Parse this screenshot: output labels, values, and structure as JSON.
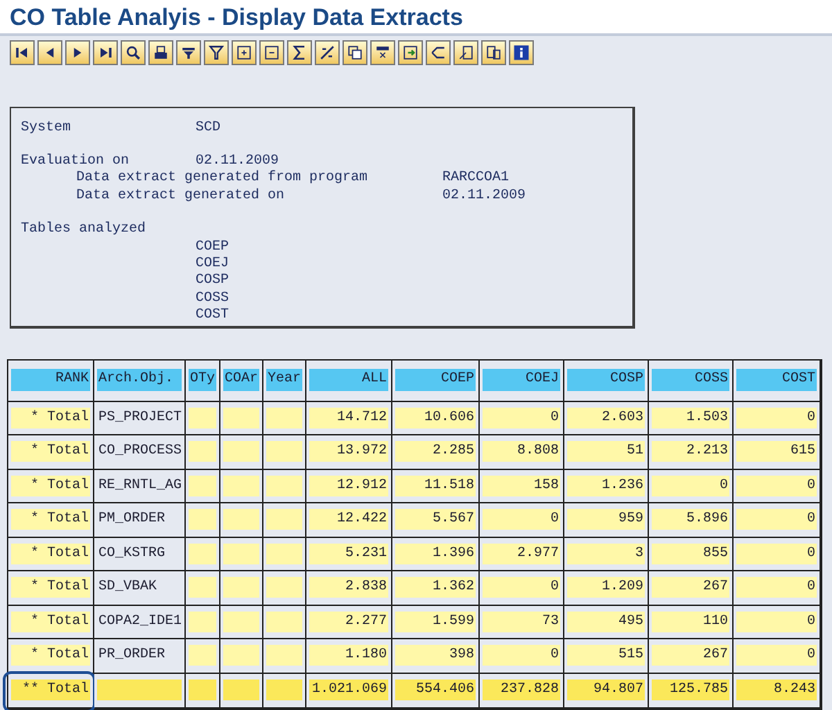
{
  "window": {
    "title": "CO Table Analyis - Display Data Extracts"
  },
  "info": {
    "system": {
      "label": "System",
      "value": "SCD"
    },
    "evaluation": {
      "label": "Evaluation on",
      "value": "02.11.2009"
    },
    "details": [
      {
        "label": "Data extract generated from program",
        "value": "RARCCOA1"
      },
      {
        "label": "Data extract generated on",
        "value": "02.11.2009"
      }
    ],
    "tables": {
      "label": "Tables analyzed",
      "items": [
        "COEP",
        "COEJ",
        "COSP",
        "COSS",
        "COST"
      ]
    }
  },
  "table": {
    "columns": [
      {
        "label": "RANK"
      },
      {
        "label": "Arch.Obj."
      },
      {
        "label": "OTy"
      },
      {
        "label": "COAr"
      },
      {
        "label": "Year"
      },
      {
        "label": "ALL"
      },
      {
        "label": "COEP"
      },
      {
        "label": "COEJ"
      },
      {
        "label": "COSP"
      },
      {
        "label": "COSS"
      },
      {
        "label": "COST"
      }
    ],
    "rows": [
      {
        "kind": "subtotal",
        "highlighted": false,
        "cells": [
          "* Total",
          "PS_PROJECT",
          "",
          "",
          "",
          "14.712",
          "10.606",
          "0",
          "2.603",
          "1.503",
          "0"
        ]
      },
      {
        "kind": "subtotal",
        "highlighted": false,
        "cells": [
          "* Total",
          "CO_PROCESS",
          "",
          "",
          "",
          "13.972",
          "2.285",
          "8.808",
          "51",
          "2.213",
          "615"
        ]
      },
      {
        "kind": "subtotal",
        "highlighted": false,
        "cells": [
          "* Total",
          "RE_RNTL_AG",
          "",
          "",
          "",
          "12.912",
          "11.518",
          "158",
          "1.236",
          "0",
          "0"
        ]
      },
      {
        "kind": "subtotal",
        "highlighted": false,
        "cells": [
          "* Total",
          "PM_ORDER",
          "",
          "",
          "",
          "12.422",
          "5.567",
          "0",
          "959",
          "5.896",
          "0"
        ]
      },
      {
        "kind": "subtotal",
        "highlighted": false,
        "cells": [
          "* Total",
          "CO_KSTRG",
          "",
          "",
          "",
          "5.231",
          "1.396",
          "2.977",
          "3",
          "855",
          "0"
        ]
      },
      {
        "kind": "subtotal",
        "highlighted": false,
        "cells": [
          "* Total",
          "SD_VBAK",
          "",
          "",
          "",
          "2.838",
          "1.362",
          "0",
          "1.209",
          "267",
          "0"
        ]
      },
      {
        "kind": "subtotal",
        "highlighted": false,
        "cells": [
          "* Total",
          "COPA2_IDE1",
          "",
          "",
          "",
          "2.277",
          "1.599",
          "73",
          "495",
          "110",
          "0"
        ]
      },
      {
        "kind": "subtotal",
        "highlighted": false,
        "cells": [
          "* Total",
          "PR_ORDER",
          "",
          "",
          "",
          "1.180",
          "398",
          "0",
          "515",
          "267",
          "0"
        ]
      },
      {
        "kind": "total",
        "highlighted": true,
        "cells": [
          "** Total",
          "",
          "",
          "",
          "",
          "1.021.069",
          "554.406",
          "237.828",
          "94.807",
          "125.785",
          "8.243"
        ]
      }
    ]
  }
}
